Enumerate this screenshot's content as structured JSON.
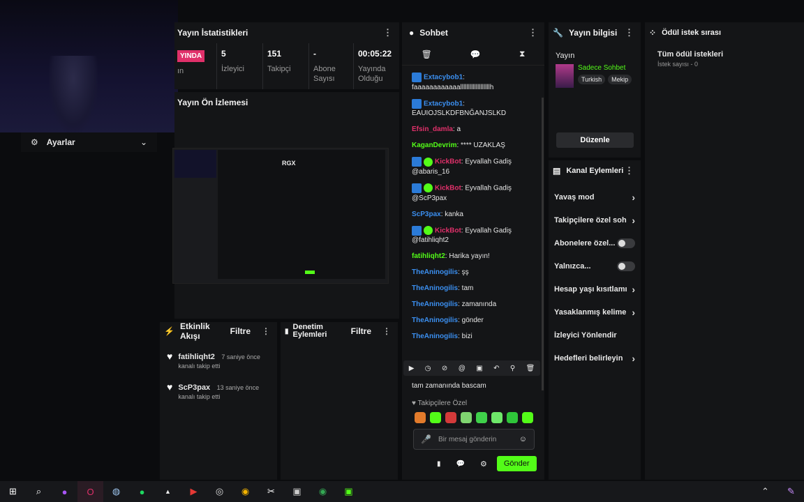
{
  "stats_panel": {
    "title": "Yayın İstatistikleri",
    "live_badge": "YINDA",
    "live_sub": "ın",
    "stats": [
      {
        "value": "5",
        "label": "İzleyici"
      },
      {
        "value": "151",
        "label": "Takipçi"
      },
      {
        "value": "-",
        "label": "Abone Sayısı"
      },
      {
        "value": "00:05:22",
        "label": "Yayında Olduğu"
      }
    ]
  },
  "preview_panel": {
    "title": "Yayın Ön İzlemesi",
    "preview_label": "RGX"
  },
  "settings_bar": {
    "label": "Ayarlar"
  },
  "activity_panel": {
    "title": "Etkinlik Akışı",
    "filter": "Filtre",
    "events": [
      {
        "user": "fatihliqht2",
        "time": "7 saniye önce",
        "text": "kanalı takip etti"
      },
      {
        "user": "ScP3pax",
        "time": "13 saniye önce",
        "text": "kanalı takip etti"
      }
    ]
  },
  "moderation_panel": {
    "title": "Denetim Eylemleri",
    "filter": "Filtre"
  },
  "chat_panel": {
    "title": "Sohbet",
    "messages": [
      {
        "user": "Extacybob1",
        "text": "faaaaaaaaaaaalllllllllllllllllllh",
        "badge": "sq",
        "color": "#3b8ff0",
        "block": true
      },
      {
        "user": "Extacybob1",
        "text": "EAUIOJSLKDFBNĞANJSLKD",
        "badge": "sq",
        "color": "#3b8ff0",
        "block": true
      },
      {
        "user": "Efsin_damla",
        "text": "a",
        "badge": "",
        "color": "#e0306a",
        "block": false
      },
      {
        "user": "KaganDevrim",
        "text": "**** UZAKLAŞ",
        "badge": "",
        "color": "#53fc18",
        "block": false
      },
      {
        "user": "KickBot",
        "text": "Eyvallah Gadiş @abaris_16",
        "badge": "both",
        "color": "#e0306a",
        "block": false
      },
      {
        "user": "KickBot",
        "text": "Eyvallah Gadiş @ScP3pax",
        "badge": "both",
        "color": "#e0306a",
        "block": false
      },
      {
        "user": "ScP3pax",
        "text": "kanka",
        "badge": "",
        "color": "#3b8ff0",
        "block": false
      },
      {
        "user": "KickBot",
        "text": "Eyvallah Gadiş @fatihliqht2",
        "badge": "both",
        "color": "#e0306a",
        "block": false
      },
      {
        "user": "fatihliqht2",
        "text": "Harika yayın!",
        "badge": "",
        "color": "#53fc18",
        "block": false
      },
      {
        "user": "TheAninogilis",
        "text": "şş",
        "badge": "",
        "color": "#3b8ff0",
        "block": false
      },
      {
        "user": "TheAninogilis",
        "text": "tam",
        "badge": "",
        "color": "#3b8ff0",
        "block": false
      },
      {
        "user": "TheAninogilis",
        "text": "zamanında",
        "badge": "",
        "color": "#3b8ff0",
        "block": false
      },
      {
        "user": "TheAninogilis",
        "text": "gönder",
        "badge": "",
        "color": "#3b8ff0",
        "block": false
      },
      {
        "user": "TheAninogilis",
        "text": "bizi",
        "badge": "",
        "color": "#3b8ff0",
        "block": false
      }
    ],
    "partial_text": "tam zamanında bascam",
    "followers_only": "Takipçilere Özel",
    "input_placeholder": "Bir mesaj gönderin",
    "send_button": "Gönder"
  },
  "info_panel": {
    "title": "Yayın bilgisi",
    "section": "Yayın",
    "category": "Sadece Sohbet",
    "tags": [
      "Turkish",
      "Mekip"
    ],
    "edit_button": "Düzenle"
  },
  "channel_actions": {
    "title": "Kanal Eylemleri",
    "rows": [
      {
        "label": "Yavaş mod",
        "control": "chevron"
      },
      {
        "label": "Takipçilere özel soh",
        "control": "chevron"
      },
      {
        "label": "Abonelere özel...",
        "control": "toggle"
      },
      {
        "label": "Yalnızca...",
        "control": "toggle"
      },
      {
        "label": "Hesap yaşı kısıtlamı",
        "control": "chevron"
      },
      {
        "label": "Yasaklanmış kelime",
        "control": "chevron"
      },
      {
        "label": "İzleyici Yönlendir",
        "control": "none"
      },
      {
        "label": "Hedefleri belirleyin",
        "control": "chevron"
      }
    ]
  },
  "reward_panel": {
    "title": "Ödül istek sırası",
    "all_requests": "Tüm ödül istekleri",
    "count_text": "İstek sayısı - 0"
  },
  "colors": {
    "accent": "#53fc18",
    "live": "#e0306a",
    "panel": "#141517",
    "bg": "#0b0c0e"
  }
}
